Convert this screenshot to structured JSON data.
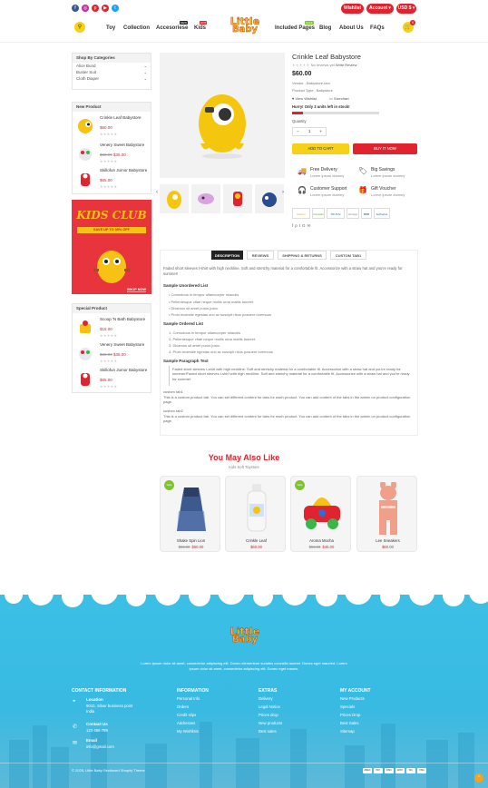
{
  "header": {
    "social": [
      {
        "icon": "facebook-icon",
        "glyph": "f",
        "color": "#3b5998"
      },
      {
        "icon": "instagram-icon",
        "glyph": "◎",
        "color": "#c32aa3"
      },
      {
        "icon": "pinterest-icon",
        "glyph": "p",
        "color": "#e0232e"
      },
      {
        "icon": "youtube-icon",
        "glyph": "▶",
        "color": "#e0232e"
      },
      {
        "icon": "twitter-icon",
        "glyph": "t",
        "color": "#1da1f2"
      }
    ],
    "wishlist_label": "Wishlist",
    "account_label": "Account",
    "currency_label": "USD $",
    "nav": [
      "Toy",
      "Collection",
      "Accesoriese",
      "Kids",
      "Included Pages",
      "Blog",
      "About Us",
      "FAQs"
    ],
    "badges": {
      "new": "NEW",
      "hot": "HOT",
      "sale": "SALE"
    },
    "logo_line1": "Little",
    "logo_line2": "Baby",
    "cart_count": "0"
  },
  "sidebar": {
    "categories_title": "Shop By Categories",
    "categories": [
      "Alice Bund",
      "Buster Suit",
      "Cloth Diaper"
    ],
    "new_product_title": "New Product",
    "new_products": [
      {
        "name": "Crinkle Leaf Babystore",
        "old": "",
        "price": "$60.00"
      },
      {
        "name": "Venery Sweet Babystore",
        "old": "$38.00",
        "price": "$35.00"
      },
      {
        "name": "Skillofun Jumor Babystore",
        "old": "",
        "price": "$65.00"
      }
    ],
    "banner_title": "KIDS CLUB",
    "banner_sub": "SAVE UP TO 35% OFF",
    "banner_btn": "SHOP NOW",
    "special_title": "Special Product",
    "special_products": [
      {
        "name": "Scoop 'N Bath Babystore",
        "old": "",
        "price": "$15.00"
      },
      {
        "name": "Venery Sweet Babystore",
        "old": "$38.00",
        "price": "$35.00"
      },
      {
        "name": "Skillofun Jumor Babystore",
        "old": "",
        "price": "$65.00"
      }
    ],
    "stars": "★★★★★"
  },
  "product": {
    "title": "Crinkle Leaf Babystore",
    "reviews": "No reviews yet",
    "write_review": "Write Review",
    "price": "$60.00",
    "vendor": "Vendor : Babystore-iam",
    "type": "Product Type : Babystore",
    "wishlist": "View Wishlist",
    "size_chart": "Sizechart",
    "stock": "Hurry! Only 3 units left in stock!",
    "stock_fraction": 0.12,
    "qty_label": "Quantity",
    "qty_value": "1",
    "add_to_cart": "ADD TO CART",
    "buy_now": "BUY IT NOW",
    "features": [
      {
        "title": "Free Delivery",
        "sub": "Lorem ipsum dummy",
        "icon": "truck-icon"
      },
      {
        "title": "Big Savings",
        "sub": "Lorem ipsum dummy",
        "icon": "tag-icon"
      },
      {
        "title": "Customer Support",
        "sub": "Lorem ipsum dummy",
        "icon": "headset-icon"
      },
      {
        "title": "Gift Voucher",
        "sub": "Lorem ipsum dummy",
        "icon": "gift-icon"
      }
    ],
    "trust": [
      "Norton",
      "Comodo",
      "TRUSTe",
      "Verisign",
      "BBB",
      "Authorize"
    ]
  },
  "tabs": [
    "DESCRIPTION",
    "REVIEWS",
    "SHIPPING & RETURNS",
    "CUSTOM TAB1"
  ],
  "description": {
    "intro": "Faded short sleeves t-shirt with high neckline. Soft and stretchy material for a comfortable fit. Accessorize with a straw hat and you're ready for summer!",
    "h1": "Sample Unordered List",
    "ul": [
      "Comodous in tempor ullamcorper miaculis",
      "Pellentesque vitae neque mollis urna mattis laoreet.",
      "Divamus sit amet purus justo.",
      "Proin molestie egestas orci ac suscipit risus posuere loremous"
    ],
    "h2": "Sample Ordered List",
    "ol": [
      "1. Comodous in tempor ullamcorper miaculis",
      "2. Pellentesque vitae neque mollis urna mattis laoreet.",
      "3. Divamus sit amet purus justo.",
      "4. Proin molestie egestas orci ac suscipit risus posuere loremous"
    ],
    "h3": "Sample Paragraph Text",
    "para": "Faded short sleeves t-shirt with high neckline. Soft and stretchy material for a comfortable fit. Accessorize with a straw hat and you're ready for summer!Faded short sleeves t-shirt with high neckline. Soft and stretchy material for a comfortable fit. Accessorize with a straw hat and you're ready for summer",
    "c1": "custom tab1",
    "c1txt": "This is a custom product tab. You can set different content for tabs for each product. You can add content of the tabs in the admin on product configuration page.",
    "c2": "custom tab2",
    "c2txt": "This is a custom product tab. You can set different content for tabs for each product. You can add content of the tabs in the admin on product configuration page."
  },
  "related": {
    "title": "You May Also Like",
    "subtitle": "Kids Soft Toystore",
    "sale": "Sale",
    "items": [
      {
        "name": "Shake Spin Lion",
        "old": "$55.00",
        "price": "$50.00",
        "sale": true
      },
      {
        "name": "Crinkle Leaf",
        "old": "",
        "price": "$60.00",
        "sale": false
      },
      {
        "name": "Aroma Mocha",
        "old": "$55.00",
        "price": "$45.00",
        "sale": true
      },
      {
        "name": "Lee Sneakers",
        "old": "",
        "price": "$60.00",
        "sale": false
      }
    ]
  },
  "footer": {
    "blurb": "Lorem ipsum dolor sit amet, consectetur adipiscing elit. Donec elementum sodales convallis laoreet. Donec eget mauried. Lorem ipsum dolor sit amet, consectetur adipiscing elit. Donec eget mauris.",
    "contact_title": "CONTACT INFORMATION",
    "location_label": "Location",
    "location": "9010, Silver business point India",
    "contact_label": "Contact Us",
    "phone": "123 456 789",
    "email_label": "Email",
    "email": "info@gmail.com",
    "info_title": "INFORMATION",
    "info": [
      "Personal Info",
      "Orders",
      "Credit slips",
      "Addresses",
      "My Wishlists"
    ],
    "extras_title": "EXTRAS",
    "extras": [
      "Delivery",
      "Legal Notice",
      "Prices drop",
      "New products",
      "Best sales"
    ],
    "account_title": "MY ACCOUNT",
    "account": [
      "New Products",
      "Specials",
      "Prices Drop",
      "Best Sales",
      "Sitemap"
    ],
    "copyright": "© 2025, Little Baby Sectioned Shopify Theme",
    "payments": [
      "AMEX",
      "PAY",
      "DISC",
      "GPAY",
      "MC",
      "VISA"
    ]
  }
}
